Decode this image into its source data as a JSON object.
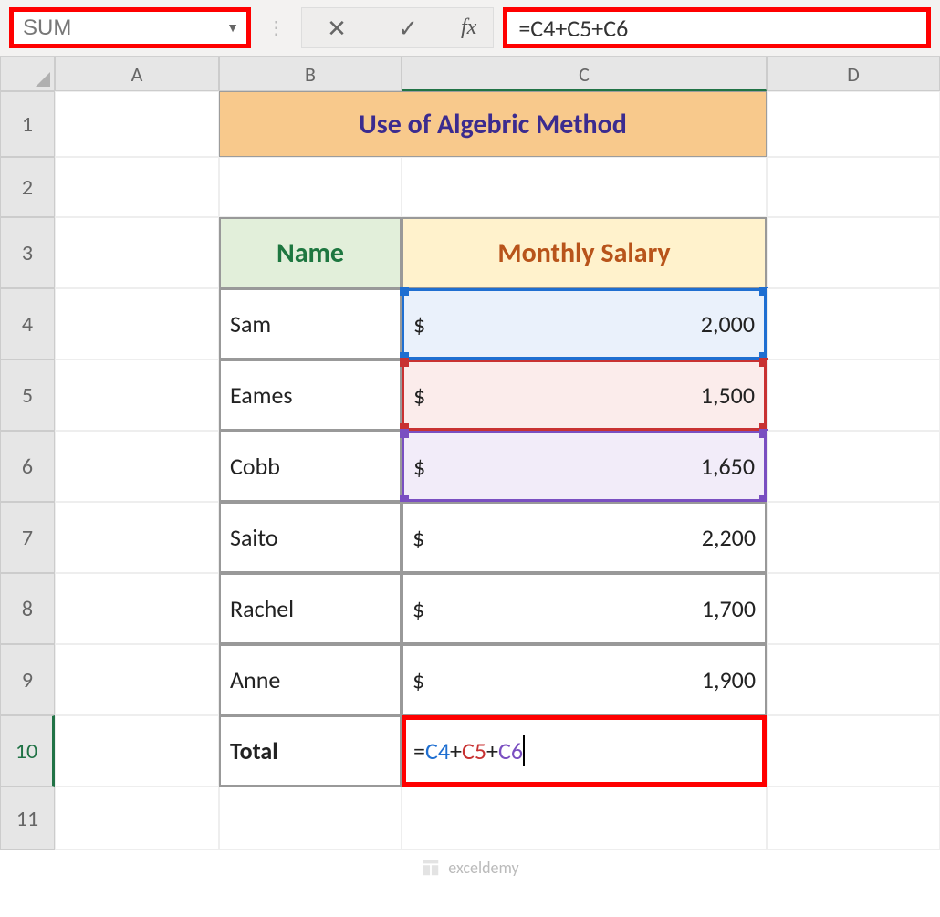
{
  "name_box": {
    "value": "SUM"
  },
  "formula_bar": {
    "cancel_glyph": "✕",
    "enter_glyph": "✓",
    "fx_label": "fx",
    "formula": "=C4+C5+C6"
  },
  "columns": [
    "A",
    "B",
    "C",
    "D"
  ],
  "rows": [
    "1",
    "2",
    "3",
    "4",
    "5",
    "6",
    "7",
    "8",
    "9",
    "10",
    "11"
  ],
  "title": "Use of Algebric Method",
  "headers": {
    "name": "Name",
    "salary": "Monthly Salary"
  },
  "data": [
    {
      "name": "Sam",
      "currency": "$",
      "salary": "2,000"
    },
    {
      "name": "Eames",
      "currency": "$",
      "salary": "1,500"
    },
    {
      "name": "Cobb",
      "currency": "$",
      "salary": "1,650"
    },
    {
      "name": "Saito",
      "currency": "$",
      "salary": "2,200"
    },
    {
      "name": "Rachel",
      "currency": "$",
      "salary": "1,700"
    },
    {
      "name": "Anne",
      "currency": "$",
      "salary": "1,900"
    }
  ],
  "total_label": "Total",
  "cell_formula": {
    "eq": "=",
    "p1": "C4",
    "op1": "+",
    "p2": "C5",
    "op2": "+",
    "p3": "C6"
  },
  "watermark": "exceldemy"
}
